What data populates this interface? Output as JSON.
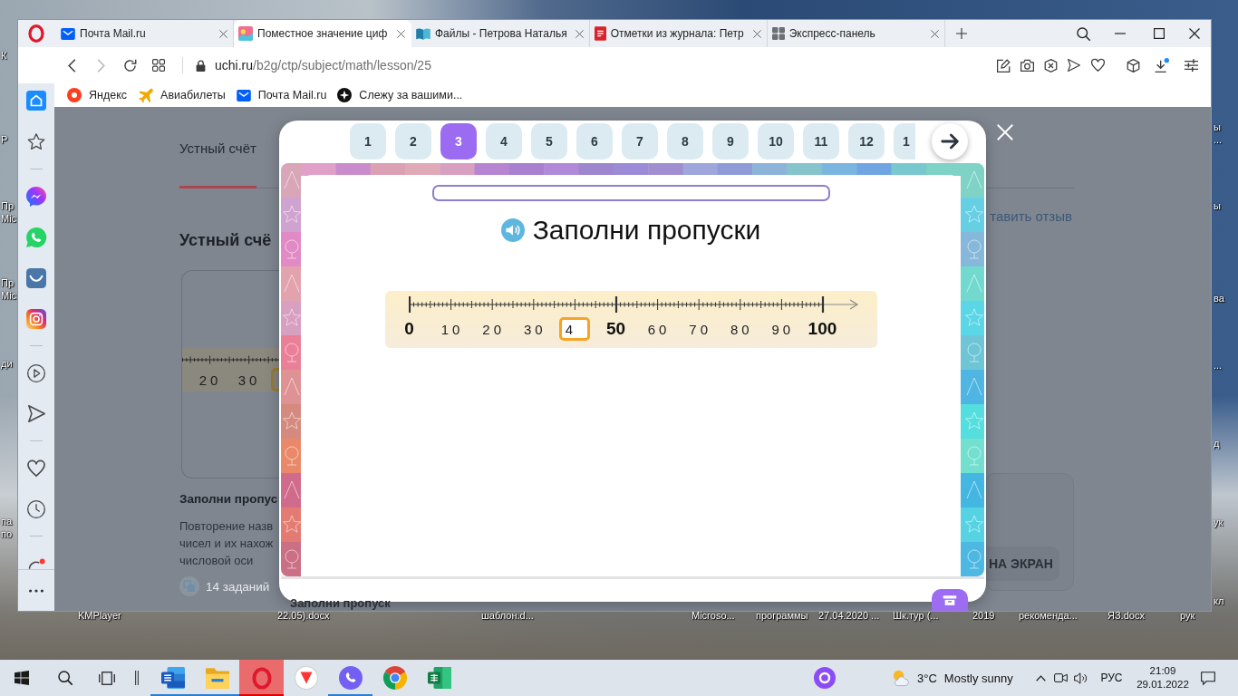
{
  "desktop": {
    "left_edge_labels": [
      "К",
      "Р",
      "Пр",
      "Mic",
      "Пр",
      "Mic",
      "ди",
      "па",
      "по"
    ],
    "right_edge_labels": [
      "ы",
      "...",
      "ы",
      "ва",
      "...",
      "д",
      "ук",
      "кл"
    ],
    "bottom_labels": [
      "KMPlayer",
      "22.05).docx",
      "шаблон.d...",
      "Microso...",
      "программы",
      "27.04.2020 ...",
      "Шк.тур (...",
      "2019",
      "рекоменда...",
      "ЯЗ.docx",
      "рук"
    ]
  },
  "browser": {
    "tabs": [
      {
        "title": "Почта Mail.ru",
        "selected": false
      },
      {
        "title": "Поместное значение циф",
        "selected": true
      },
      {
        "title": "Файлы - Петрова Наталья",
        "selected": false
      },
      {
        "title": "Отметки из журнала: Петр",
        "selected": false
      },
      {
        "title": "Экспресс-панель",
        "selected": false
      }
    ],
    "navigation": {
      "back_enabled": true,
      "forward_enabled": false
    },
    "address": {
      "host": "uchi.ru",
      "path": "/b2g/ctp/subject/math/lesson/25"
    },
    "bookmarks": [
      "Яндекс",
      "Авиабилеты",
      "Почта Mail.ru",
      "Слежу за вашими..."
    ]
  },
  "page": {
    "tabs": [
      {
        "label": "Устный счёт",
        "selected": true
      }
    ],
    "heading": "Устный счё",
    "lesson_card": {
      "axis_labels": [
        "20",
        "30"
      ]
    },
    "lesson_title": "Заполни пропус",
    "description_lines": [
      "Повторение назв",
      "чисел и их нахож",
      "числовой оси"
    ],
    "task_count": "14 заданий",
    "feedback_link": "тавить отзыв",
    "screen_button": "НА ЭКРАН"
  },
  "modal": {
    "pages": [
      {
        "label": "1",
        "selected": false
      },
      {
        "label": "2",
        "selected": false
      },
      {
        "label": "3",
        "selected": true
      },
      {
        "label": "4",
        "selected": false
      },
      {
        "label": "5",
        "selected": false
      },
      {
        "label": "6",
        "selected": false
      },
      {
        "label": "7",
        "selected": false
      },
      {
        "label": "8",
        "selected": false
      },
      {
        "label": "9",
        "selected": false
      },
      {
        "label": "10",
        "selected": false
      },
      {
        "label": "11",
        "selected": false
      },
      {
        "label": "12",
        "selected": false
      },
      {
        "label": "1",
        "selected": false,
        "cut": true
      }
    ],
    "progress": {
      "level": 0
    },
    "title": "Заполни пропуски",
    "number_line": {
      "labels": [
        {
          "kind": "major",
          "text": "0"
        },
        {
          "kind": "minor",
          "text": "10"
        },
        {
          "kind": "minor",
          "text": "20"
        },
        {
          "kind": "minor",
          "text": "30"
        },
        {
          "kind": "blank",
          "value": "4"
        },
        {
          "kind": "major",
          "text": "50"
        },
        {
          "kind": "minor",
          "text": "60"
        },
        {
          "kind": "minor",
          "text": "70"
        },
        {
          "kind": "minor",
          "text": "80"
        },
        {
          "kind": "minor",
          "text": "90"
        },
        {
          "kind": "major",
          "text": "100"
        }
      ]
    },
    "footer_title": "Заполни пропуск"
  },
  "taskbar": {
    "apps": [
      {
        "open": true,
        "selected": false
      },
      {
        "open": true,
        "selected": false
      },
      {
        "open": true,
        "selected": true
      },
      {
        "open": false,
        "selected": false
      },
      {
        "open": true,
        "selected": false
      },
      {
        "open": false,
        "selected": false
      },
      {
        "open": false,
        "selected": false
      }
    ],
    "weather": {
      "temperature": "3°C",
      "condition": "Mostly sunny"
    },
    "language": "РУС",
    "time": "21:09",
    "date": "29.01.2022"
  }
}
